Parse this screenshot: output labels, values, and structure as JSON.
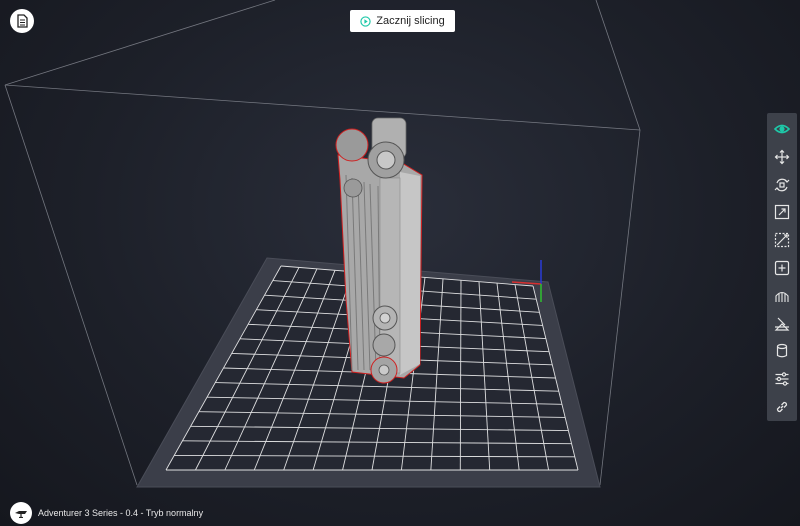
{
  "toolbar_top": {
    "slice_button_label": "Zacznij slicing",
    "slice_icon": "play-circle-icon",
    "document_icon": "document-icon"
  },
  "right_toolbar": {
    "active_color": "#1ec8a8",
    "icon_color": "#e6e6e6",
    "tools": [
      {
        "icon": "eye-icon",
        "active": true
      },
      {
        "icon": "move-icon",
        "active": false
      },
      {
        "icon": "rotate-icon",
        "active": false
      },
      {
        "icon": "scale-icon",
        "active": false
      },
      {
        "icon": "mirror-icon",
        "active": false
      },
      {
        "icon": "add-model-icon",
        "active": false
      },
      {
        "icon": "support-icon",
        "active": false
      },
      {
        "icon": "cut-icon",
        "active": false
      },
      {
        "icon": "material-icon",
        "active": false
      },
      {
        "icon": "settings-sliders-icon",
        "active": false
      },
      {
        "icon": "link-icon",
        "active": false
      }
    ]
  },
  "status_bar": {
    "printer_text": "Adventurer 3 Series - 0.4 - Tryb normalny",
    "printer_icon": "printer-icon"
  },
  "colors": {
    "background": "#1d2029",
    "plate": "#3b3e49",
    "grid": "#ffffff",
    "model": "#a6a6a6",
    "model_outline": "#d02020"
  }
}
